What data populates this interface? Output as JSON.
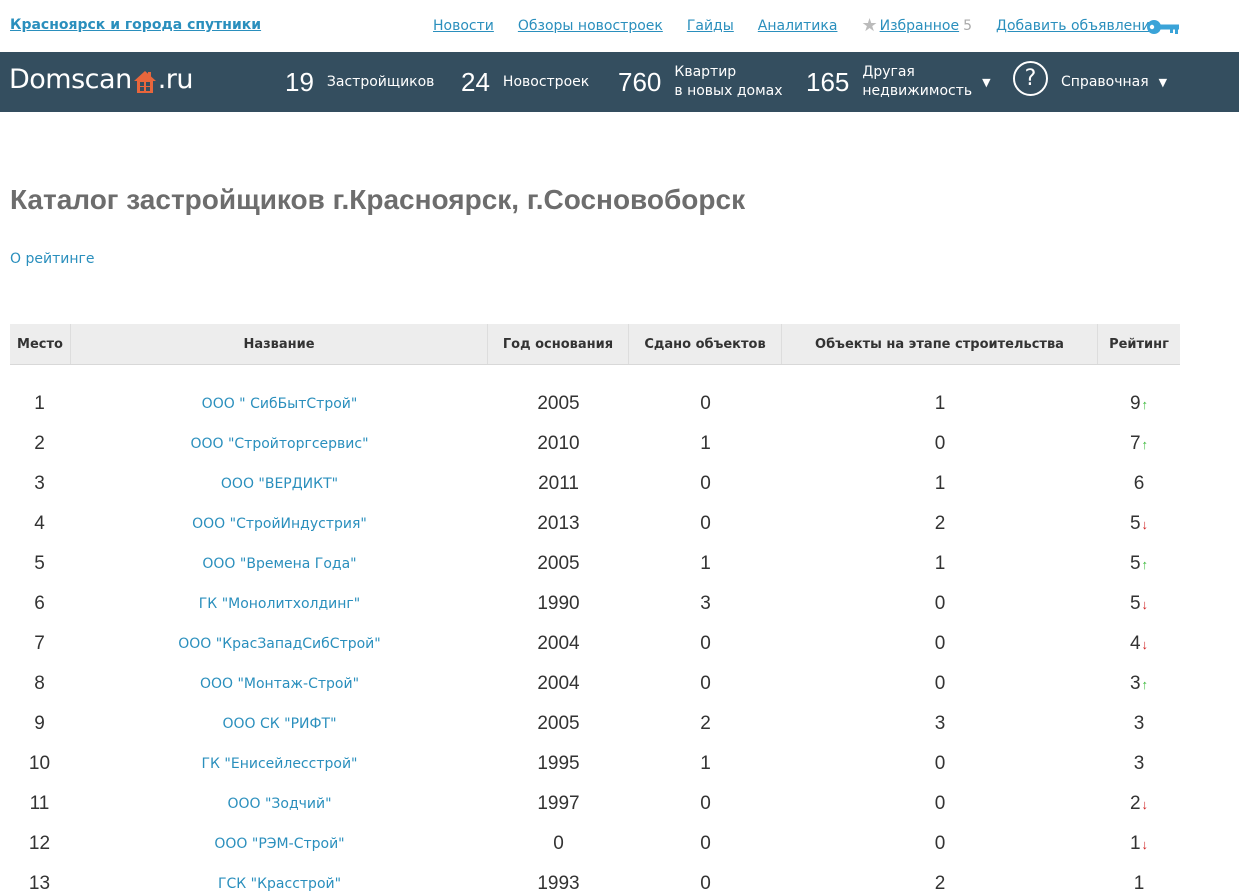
{
  "topbar": {
    "region": "Красноярск и города спутники",
    "nav": [
      "Новости",
      "Обзоры новостроек",
      "Гайды",
      "Аналитика"
    ],
    "favorites_label": "Избранное",
    "favorites_count": "5",
    "add_ad": "Добавить объявление"
  },
  "header": {
    "logo_left": "Domscan",
    "logo_right": ".ru",
    "stats": [
      {
        "num": "19",
        "label": "Застройщиков"
      },
      {
        "num": "24",
        "label": "Новостроек"
      },
      {
        "num": "760",
        "label_line1": "Квартир",
        "label_line2": "в новых домах"
      },
      {
        "num": "165",
        "label_line1": "Другая",
        "label_line2": "недвижимость"
      }
    ],
    "help_symbol": "?",
    "reference": "Справочная"
  },
  "page": {
    "title": "Каталог застройщиков г.Красноярск, г.Сосновоборск",
    "about_link": "О рейтинге"
  },
  "table": {
    "headers": [
      "Место",
      "Название",
      "Год основания",
      "Сдано объектов",
      "Объекты на этапе строительства",
      "Рейтинг"
    ],
    "rows": [
      {
        "place": "1",
        "name": "ООО \" СибБытСтрой\"",
        "year": "2005",
        "done": "0",
        "building": "1",
        "rating": "9",
        "trend": "up"
      },
      {
        "place": "2",
        "name": "ООО \"Стройторгсервис\"",
        "year": "2010",
        "done": "1",
        "building": "0",
        "rating": "7",
        "trend": "up"
      },
      {
        "place": "3",
        "name": "ООО \"ВЕРДИКТ\"",
        "year": "2011",
        "done": "0",
        "building": "1",
        "rating": "6",
        "trend": "none"
      },
      {
        "place": "4",
        "name": "ООО \"СтройИндустрия\"",
        "year": "2013",
        "done": "0",
        "building": "2",
        "rating": "5",
        "trend": "down"
      },
      {
        "place": "5",
        "name": "ООО \"Времена Года\"",
        "year": "2005",
        "done": "1",
        "building": "1",
        "rating": "5",
        "trend": "up"
      },
      {
        "place": "6",
        "name": "ГК \"Монолитхолдинг\"",
        "year": "1990",
        "done": "3",
        "building": "0",
        "rating": "5",
        "trend": "down"
      },
      {
        "place": "7",
        "name": "ООО \"КрасЗападСибСтрой\"",
        "year": "2004",
        "done": "0",
        "building": "0",
        "rating": "4",
        "trend": "down"
      },
      {
        "place": "8",
        "name": "ООО \"Монтаж-Строй\"",
        "year": "2004",
        "done": "0",
        "building": "0",
        "rating": "3",
        "trend": "up"
      },
      {
        "place": "9",
        "name": "ООО СК \"РИФТ\"",
        "year": "2005",
        "done": "2",
        "building": "3",
        "rating": "3",
        "trend": "none"
      },
      {
        "place": "10",
        "name": "ГК \"Енисейлесстрой\"",
        "year": "1995",
        "done": "1",
        "building": "0",
        "rating": "3",
        "trend": "none"
      },
      {
        "place": "11",
        "name": "ООО \"Зодчий\"",
        "year": "1997",
        "done": "0",
        "building": "0",
        "rating": "2",
        "trend": "down"
      },
      {
        "place": "12",
        "name": "ООО \"РЭМ-Строй\"",
        "year": "0",
        "done": "0",
        "building": "0",
        "rating": "1",
        "trend": "down"
      },
      {
        "place": "13",
        "name": "ГСК \"Красстрой\"",
        "year": "1993",
        "done": "0",
        "building": "2",
        "rating": "1",
        "trend": "none"
      }
    ]
  },
  "colors": {
    "link": "#2a8fbd",
    "header_bg": "#344e5f",
    "logo_house": "#e8663c",
    "trend_up": "#3cba3c",
    "trend_down": "#d02020"
  }
}
